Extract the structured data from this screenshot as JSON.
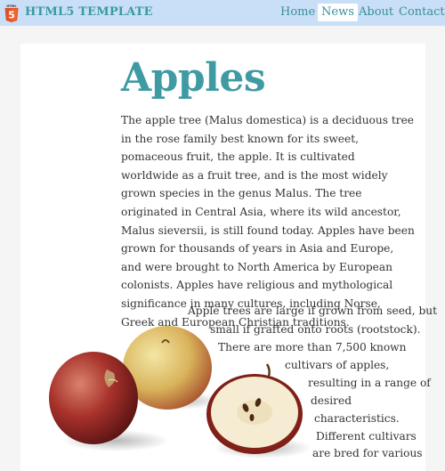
{
  "header": {
    "logo_badge_text": "HTML",
    "logo_digit": "5",
    "brand": "HTML5 TEMPLATE",
    "nav": [
      {
        "label": "Home",
        "active": false
      },
      {
        "label": "News",
        "active": true
      },
      {
        "label": "About",
        "active": false
      },
      {
        "label": "Contact",
        "active": false
      }
    ]
  },
  "article": {
    "title": "Apples",
    "paragraph1": "The apple tree (Malus domestica) is a deciduous tree in the rose family best known for its sweet, pomaceous fruit, the apple. It is cultivated worldwide as a fruit tree, and is the most widely grown species in the genus Malus. The tree originated in Central Asia, where its wild ancestor, Malus sieversii, is still found today. Apples have been grown for thousands of years in Asia and Europe, and were brought to North America by European colonists. Apples have religious and mythological significance in many cultures, including Norse, Greek and European Christian traditions.",
    "paragraph2_lines": [
      "Apple trees are large if grown from seed, but",
      "small if grafted onto roots (rootstock).",
      "There are more than 7,500 known",
      "cultivars of apples,",
      "resulting in a range of",
      "desired",
      "characteristics.",
      "Different cultivars",
      "are bred for various"
    ]
  },
  "colors": {
    "header_bg": "#c9dff7",
    "accent": "#3f9ba3",
    "html5_orange": "#e44d26"
  }
}
